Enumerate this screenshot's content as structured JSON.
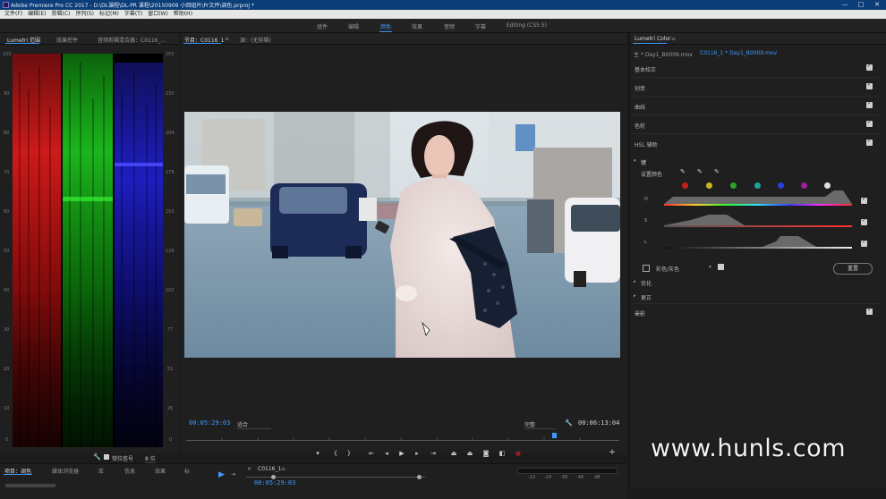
{
  "window": {
    "title": "Adobe Premiere Pro CC 2017 - D:\\DL课程\\DL-PR 课程\\20150909 小回组片\\Pr文件\\调色.prproj *",
    "min": "—",
    "max": "□",
    "close": "✕"
  },
  "menu": [
    "文件(F)",
    "编辑(E)",
    "剪辑(C)",
    "序列(S)",
    "标记(M)",
    "字幕(T)",
    "窗口(W)",
    "帮助(H)"
  ],
  "workspaces": [
    {
      "label": "组件",
      "active": false
    },
    {
      "label": "编辑",
      "active": false
    },
    {
      "label": "颜色",
      "active": true
    },
    {
      "label": "效果",
      "active": false
    },
    {
      "label": "音频",
      "active": false
    },
    {
      "label": "字幕",
      "active": false
    },
    {
      "label": "Editing (CS5.5)",
      "active": false
    }
  ],
  "scope_panel": {
    "tabs": [
      "Lumetri 范围",
      "效果控件",
      "音频剪辑混合器：C0116_..."
    ],
    "left_ticks": [
      "100",
      "90",
      "80",
      "70",
      "60",
      "50",
      "40",
      "30",
      "20",
      "10",
      "0"
    ],
    "right_ticks": [
      "255",
      "230",
      "204",
      "179",
      "153",
      "128",
      "102",
      "77",
      "51",
      "26",
      "0"
    ],
    "clamp_label": "钳位信号",
    "bit_depth": "8 位"
  },
  "program_panel": {
    "tabs": [
      "节目：C0116_1",
      "源：(无剪辑)"
    ],
    "timecode_current": "00:05:29:03",
    "fit": "适合",
    "quality": "完整",
    "timecode_duration": "00:06:13:04",
    "playhead_fraction": 0.85
  },
  "lumetri": {
    "title": "Lumetri Color",
    "source_clip": "主 * Day1_B0009.mov",
    "sequence_clip": "C0116_1 * Day1_B0009.mov",
    "sections": [
      "基本校正",
      "创意",
      "曲线",
      "色轮",
      "HSL 辅助"
    ],
    "key_label": "键",
    "set_color_label": "设置颜色",
    "hsl_labels": [
      "H",
      "S",
      "L"
    ],
    "swatch_colors": [
      "#c41e1e",
      "#c9b51d",
      "#2ea12e",
      "#1ea39a",
      "#2a3ed8",
      "#a21ea6",
      "#e0e0e0"
    ],
    "color_gray_label": "彩色/灰色",
    "reset_label": "重置",
    "subsections": [
      "优化",
      "更正"
    ],
    "vignette": "晕影"
  },
  "timeline": {
    "tabs": [
      "项目：调色",
      "媒体浏览器",
      "库",
      "信息",
      "效果",
      "标"
    ],
    "sequence_tab": "C0116_1",
    "timecode": "00:05:29:03",
    "ruler_ticks": [
      "-12",
      "-24",
      "-36",
      "-48",
      "dB"
    ]
  },
  "watermark": "www.hunls.com",
  "accent_color": "#3d9bff"
}
